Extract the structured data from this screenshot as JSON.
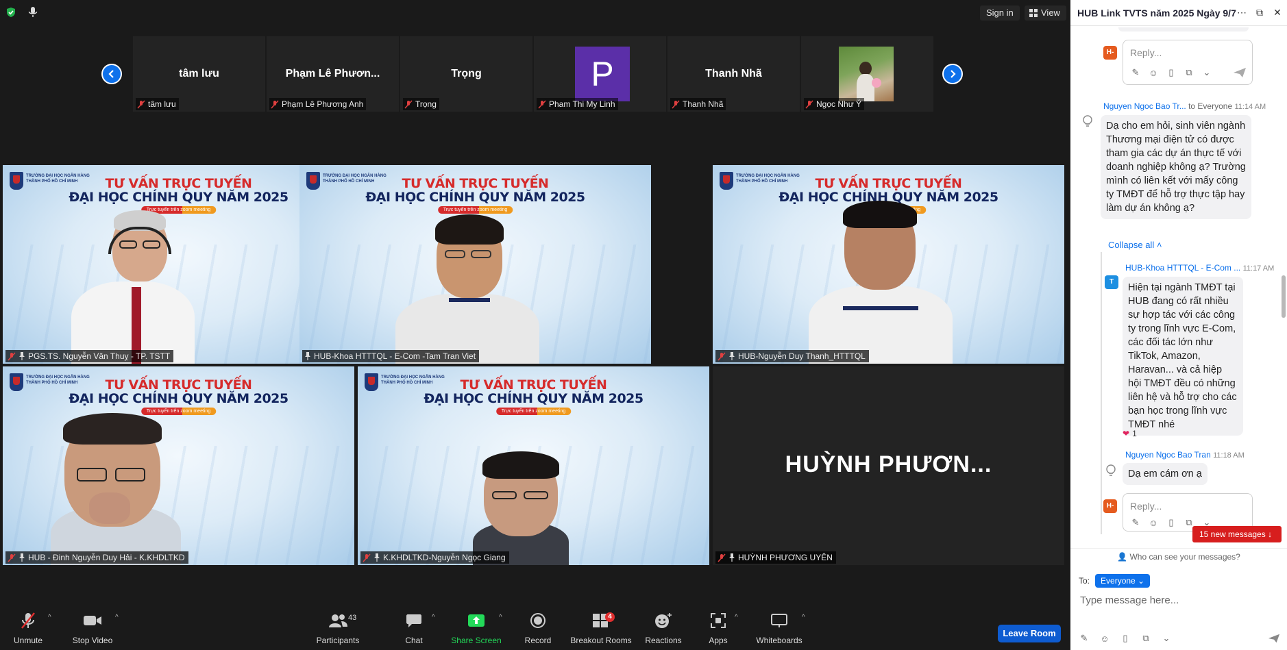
{
  "topbar": {
    "sign_in": "Sign in",
    "view": "View"
  },
  "strip": [
    {
      "name": "tâm lưu",
      "label": "tâm lưu",
      "type": "name"
    },
    {
      "name": "Phạm Lê Phươn...",
      "label": "Phạm Lê Phương Anh",
      "type": "name"
    },
    {
      "name": "Trọng",
      "label": "Trọng",
      "type": "name"
    },
    {
      "name": "P",
      "label": "Pham Thi My Linh",
      "type": "avatar"
    },
    {
      "name": "Thanh Nhã",
      "label": "Thanh Nhã",
      "type": "name"
    },
    {
      "name": "",
      "label": "Ngọc Như Ý",
      "type": "photo"
    }
  ],
  "slide": {
    "school": "TRƯỜNG ĐẠI HỌC NGÂN HÀNG THÀNH PHỐ HỒ CHÍ MINH",
    "line1": "TƯ VẤN TRỰC TUYẾN",
    "line2": "ĐẠI HỌC CHÍNH QUY NĂM 2025",
    "pill": "Trực tuyến trên zoom meeting"
  },
  "tiles": [
    {
      "label": "PGS.TS. Nguyễn Văn Thuỵ - TP. TSTT",
      "muted": true
    },
    {
      "label": "HUB-Khoa HTTTQL - E-Com -Tam Tran Viet",
      "muted": false
    },
    {
      "label": "HUB-Nguyễn Duy Thanh_HTTTQL",
      "muted": true
    },
    {
      "label": "HUB - Đinh Nguyễn Duy Hải - K.KHDLTKD",
      "muted": true
    },
    {
      "label": "K.KHDLTKD-Nguyễn Ngọc Giang",
      "muted": true
    },
    {
      "label": "HUỲNH PHƯƠNG UYÊN",
      "big_name": "HUỲNH  PHƯƠN...",
      "muted": true
    }
  ],
  "toolbar": {
    "unmute": "Unmute",
    "stop_video": "Stop Video",
    "participants": "Participants",
    "participants_count": "43",
    "chat": "Chat",
    "share_screen": "Share Screen",
    "record": "Record",
    "breakout_rooms": "Breakout Rooms",
    "breakout_badge": "4",
    "reactions": "Reactions",
    "apps": "Apps",
    "whiteboards": "Whiteboards",
    "leave": "Leave Room"
  },
  "chat": {
    "title": "HUB Link TVTS năm 2025 Ngày 9/7",
    "reply_placeholder": "Reply...",
    "reply_avatar": "H-",
    "msg1": {
      "sender": "Nguyen Ngoc Bao Tr...",
      "to": "to Everyone",
      "time": "11:14 AM",
      "text": "Dạ cho em hỏi, sinh viên ngành Thương mại điện tử có được tham gia các dự án thực tế với doanh nghiệp không ạ? Trường mình có liên kết với mấy công ty TMĐT để hỗ trợ thực tập hay làm dự án không ạ?"
    },
    "collapse": "Collapse all",
    "msg2": {
      "avatar": "T",
      "sender": "HUB-Khoa HTTTQL - E-Com ...",
      "time": "11:17 AM",
      "text": "Hiện tại ngành TMĐT tại HUB đang có rất nhiều sự hợp tác với các công ty trong lĩnh vực E-Com, các đối tác lớn như TikTok, Amazon, Haravan... và cả hiệp hội TMĐT đều có những liên hệ và hỗ trợ cho các bạn học trong lĩnh vực TMĐT nhé",
      "reaction_count": "1"
    },
    "msg3": {
      "sender": "Nguyen Ngoc Bao Tran",
      "time": "11:18 AM",
      "text": "Dạ em cám ơn ạ"
    },
    "new_messages": "15 new messages",
    "who_can_see": "Who can see your messages?",
    "to_label": "To:",
    "to_value": "Everyone",
    "type_placeholder": "Type message here..."
  },
  "colors": {
    "zoom_blue": "#0e71eb",
    "active_speaker": "#c5e63a",
    "share_green": "#23d959",
    "alert_red": "#d71e1e",
    "avatar_orange": "#e55b1f",
    "avatar_purple": "#5b2fa8"
  }
}
